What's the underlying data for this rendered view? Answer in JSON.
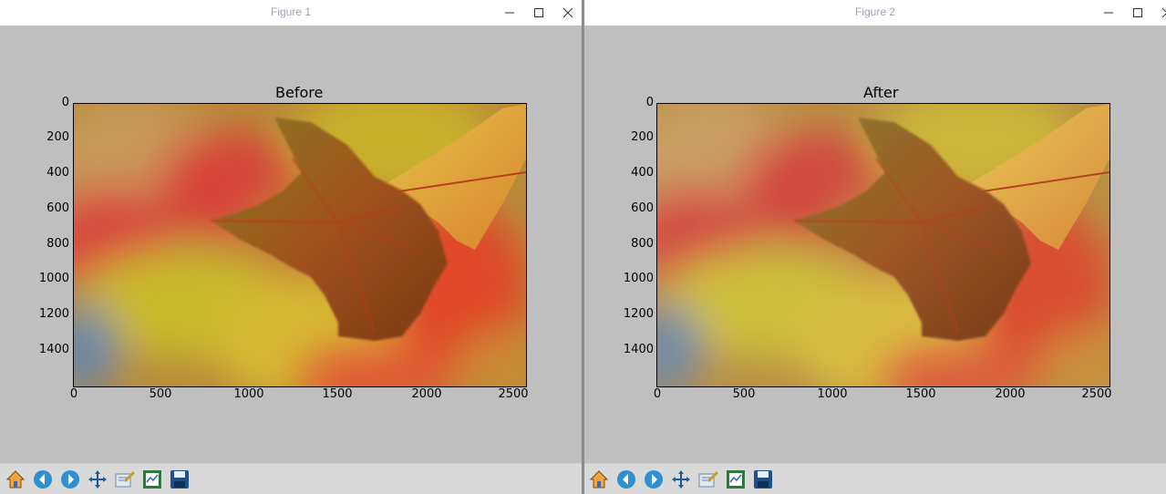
{
  "figure1": {
    "window_title": "Figure 1",
    "plot_title": "Before",
    "yticks": [
      "0",
      "200",
      "400",
      "600",
      "800",
      "1000",
      "1200",
      "1400"
    ],
    "xticks": [
      "0",
      "500",
      "1000",
      "1500",
      "2000",
      "2500"
    ],
    "image_desc": "autumn maple leaf photo"
  },
  "figure2": {
    "window_title": "Figure 2",
    "plot_title": "After",
    "yticks": [
      "0",
      "200",
      "400",
      "600",
      "800",
      "1000",
      "1200",
      "1400"
    ],
    "xticks": [
      "0",
      "500",
      "1000",
      "1500",
      "2000",
      "2500"
    ],
    "image_desc": "autumn maple leaf photo"
  },
  "toolbar_icons": [
    "home-icon",
    "back-arrow-icon",
    "forward-arrow-icon",
    "pan-icon",
    "zoom-rect-icon",
    "subplots-config-icon",
    "save-floppy-icon"
  ]
}
